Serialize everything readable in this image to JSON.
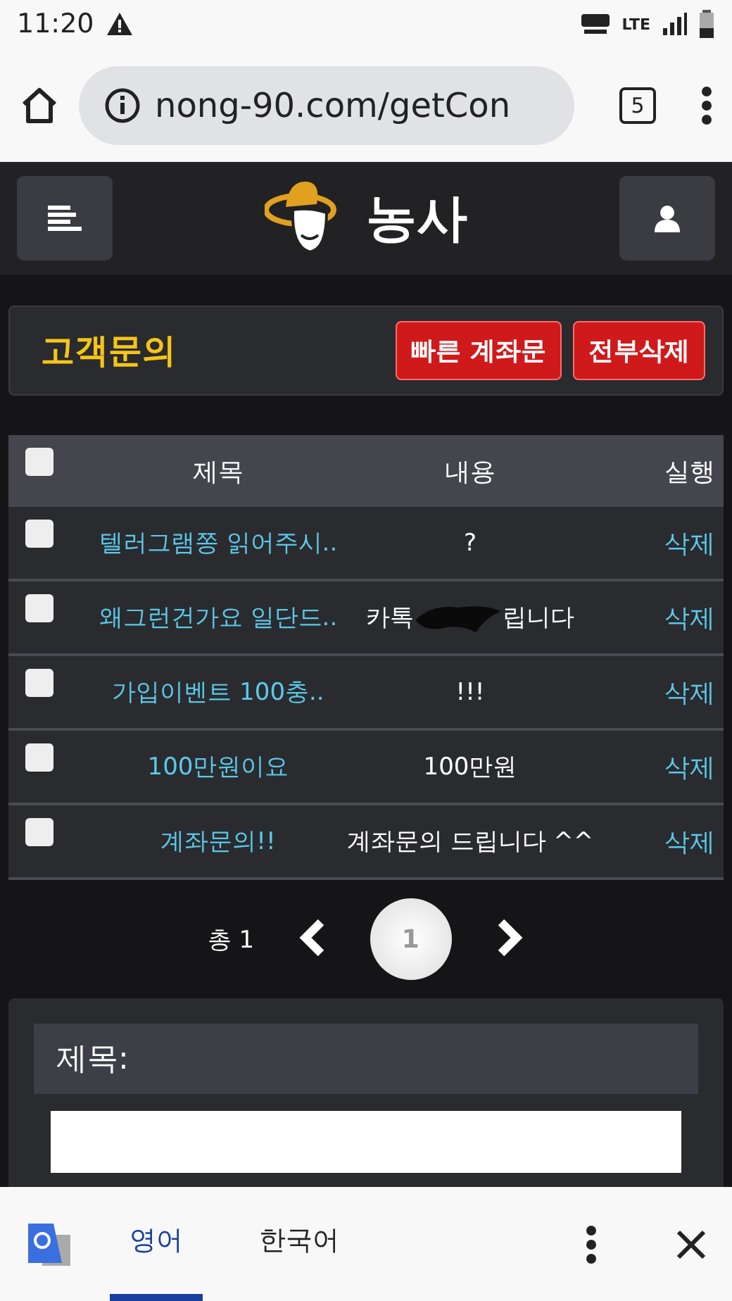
{
  "status_bar": {
    "time": "11:20",
    "network": "LTE"
  },
  "browser": {
    "url": "nong-90.com/getCon",
    "tab_count": "5"
  },
  "site_header": {
    "logo_text": "농사"
  },
  "page_title": {
    "title": "고객문의",
    "buttons": [
      "빠른 계좌문",
      "전부삭제"
    ]
  },
  "table": {
    "columns": [
      "제목",
      "내용",
      "실행"
    ],
    "select_all": {
      "checked": false
    },
    "rows": [
      {
        "title": "텔러그램쫑 읽어주시..",
        "content": [
          "?"
        ],
        "action": "삭제",
        "checked": false
      },
      {
        "title": "왜그런건가요 일단드..",
        "content": [
          "카톡",
          "립니다"
        ],
        "action": "삭제",
        "checked": false
      },
      {
        "title": "가입이벤트 100충..",
        "content": [
          "!!!"
        ],
        "action": "삭제",
        "checked": false
      },
      {
        "title": "100만원이요",
        "content": [
          "100만원"
        ],
        "action": "삭제",
        "checked": false
      },
      {
        "title": "계좌문의!!",
        "content": [
          "계좌문의 드립니다 ^^"
        ],
        "action": "삭제",
        "checked": false
      }
    ]
  },
  "pagination": {
    "total": "총 1",
    "pages": [
      {
        "label": "1",
        "selected": true
      }
    ]
  },
  "form": {
    "subject_label": "제목:"
  },
  "translate_bar": {
    "tabs": [
      {
        "label": "영어",
        "selected": true
      },
      {
        "label": "한국어",
        "selected": false
      }
    ]
  }
}
